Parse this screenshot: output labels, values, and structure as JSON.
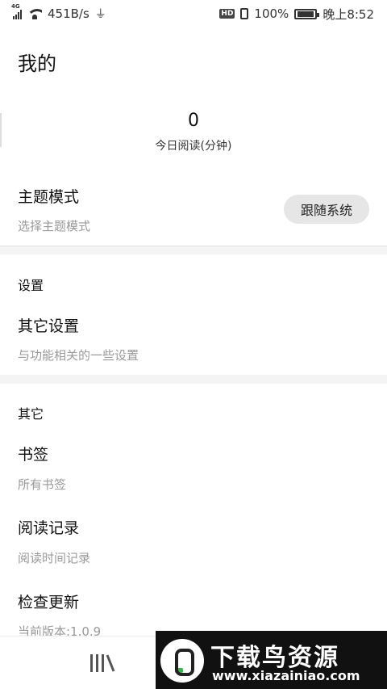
{
  "status_bar": {
    "network": "4G",
    "speed": "451B/s",
    "hd": "HD",
    "battery": "100%",
    "time": "晚上8:52"
  },
  "page": {
    "title": "我的"
  },
  "reading_stat": {
    "value": "0",
    "label": "今日阅读(分钟)"
  },
  "theme": {
    "title": "主题模式",
    "subtitle": "选择主题模式",
    "value": "跟随系统"
  },
  "settings_section": {
    "header": "设置",
    "items": [
      {
        "title": "其它设置",
        "subtitle": "与功能相关的一些设置"
      }
    ]
  },
  "other_section": {
    "header": "其它",
    "items": [
      {
        "title": "书签",
        "subtitle": "所有书签"
      },
      {
        "title": "阅读记录",
        "subtitle": "阅读时间记录"
      },
      {
        "title": "检查更新",
        "subtitle": "当前版本:1.0.9"
      }
    ]
  },
  "bottom_nav": {
    "icons": [
      "bookshelf-icon"
    ]
  },
  "watermark": {
    "name": "下载鸟资源",
    "url": "www.xiazainiao.com"
  },
  "colors": {
    "gap": "#f4f4f4",
    "pill": "#e6e6e6",
    "subtitle": "#9a9a9a"
  }
}
